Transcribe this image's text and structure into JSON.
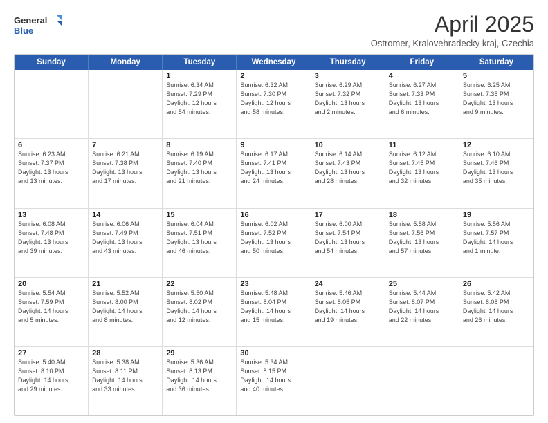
{
  "logo": {
    "line1": "General",
    "line2": "Blue"
  },
  "title": "April 2025",
  "location": "Ostromer, Kralovehradecky kraj, Czechia",
  "weekdays": [
    "Sunday",
    "Monday",
    "Tuesday",
    "Wednesday",
    "Thursday",
    "Friday",
    "Saturday"
  ],
  "rows": [
    [
      {
        "day": "",
        "info": ""
      },
      {
        "day": "",
        "info": ""
      },
      {
        "day": "1",
        "info": "Sunrise: 6:34 AM\nSunset: 7:29 PM\nDaylight: 12 hours\nand 54 minutes."
      },
      {
        "day": "2",
        "info": "Sunrise: 6:32 AM\nSunset: 7:30 PM\nDaylight: 12 hours\nand 58 minutes."
      },
      {
        "day": "3",
        "info": "Sunrise: 6:29 AM\nSunset: 7:32 PM\nDaylight: 13 hours\nand 2 minutes."
      },
      {
        "day": "4",
        "info": "Sunrise: 6:27 AM\nSunset: 7:33 PM\nDaylight: 13 hours\nand 6 minutes."
      },
      {
        "day": "5",
        "info": "Sunrise: 6:25 AM\nSunset: 7:35 PM\nDaylight: 13 hours\nand 9 minutes."
      }
    ],
    [
      {
        "day": "6",
        "info": "Sunrise: 6:23 AM\nSunset: 7:37 PM\nDaylight: 13 hours\nand 13 minutes."
      },
      {
        "day": "7",
        "info": "Sunrise: 6:21 AM\nSunset: 7:38 PM\nDaylight: 13 hours\nand 17 minutes."
      },
      {
        "day": "8",
        "info": "Sunrise: 6:19 AM\nSunset: 7:40 PM\nDaylight: 13 hours\nand 21 minutes."
      },
      {
        "day": "9",
        "info": "Sunrise: 6:17 AM\nSunset: 7:41 PM\nDaylight: 13 hours\nand 24 minutes."
      },
      {
        "day": "10",
        "info": "Sunrise: 6:14 AM\nSunset: 7:43 PM\nDaylight: 13 hours\nand 28 minutes."
      },
      {
        "day": "11",
        "info": "Sunrise: 6:12 AM\nSunset: 7:45 PM\nDaylight: 13 hours\nand 32 minutes."
      },
      {
        "day": "12",
        "info": "Sunrise: 6:10 AM\nSunset: 7:46 PM\nDaylight: 13 hours\nand 35 minutes."
      }
    ],
    [
      {
        "day": "13",
        "info": "Sunrise: 6:08 AM\nSunset: 7:48 PM\nDaylight: 13 hours\nand 39 minutes."
      },
      {
        "day": "14",
        "info": "Sunrise: 6:06 AM\nSunset: 7:49 PM\nDaylight: 13 hours\nand 43 minutes."
      },
      {
        "day": "15",
        "info": "Sunrise: 6:04 AM\nSunset: 7:51 PM\nDaylight: 13 hours\nand 46 minutes."
      },
      {
        "day": "16",
        "info": "Sunrise: 6:02 AM\nSunset: 7:52 PM\nDaylight: 13 hours\nand 50 minutes."
      },
      {
        "day": "17",
        "info": "Sunrise: 6:00 AM\nSunset: 7:54 PM\nDaylight: 13 hours\nand 54 minutes."
      },
      {
        "day": "18",
        "info": "Sunrise: 5:58 AM\nSunset: 7:56 PM\nDaylight: 13 hours\nand 57 minutes."
      },
      {
        "day": "19",
        "info": "Sunrise: 5:56 AM\nSunset: 7:57 PM\nDaylight: 14 hours\nand 1 minute."
      }
    ],
    [
      {
        "day": "20",
        "info": "Sunrise: 5:54 AM\nSunset: 7:59 PM\nDaylight: 14 hours\nand 5 minutes."
      },
      {
        "day": "21",
        "info": "Sunrise: 5:52 AM\nSunset: 8:00 PM\nDaylight: 14 hours\nand 8 minutes."
      },
      {
        "day": "22",
        "info": "Sunrise: 5:50 AM\nSunset: 8:02 PM\nDaylight: 14 hours\nand 12 minutes."
      },
      {
        "day": "23",
        "info": "Sunrise: 5:48 AM\nSunset: 8:04 PM\nDaylight: 14 hours\nand 15 minutes."
      },
      {
        "day": "24",
        "info": "Sunrise: 5:46 AM\nSunset: 8:05 PM\nDaylight: 14 hours\nand 19 minutes."
      },
      {
        "day": "25",
        "info": "Sunrise: 5:44 AM\nSunset: 8:07 PM\nDaylight: 14 hours\nand 22 minutes."
      },
      {
        "day": "26",
        "info": "Sunrise: 5:42 AM\nSunset: 8:08 PM\nDaylight: 14 hours\nand 26 minutes."
      }
    ],
    [
      {
        "day": "27",
        "info": "Sunrise: 5:40 AM\nSunset: 8:10 PM\nDaylight: 14 hours\nand 29 minutes."
      },
      {
        "day": "28",
        "info": "Sunrise: 5:38 AM\nSunset: 8:11 PM\nDaylight: 14 hours\nand 33 minutes."
      },
      {
        "day": "29",
        "info": "Sunrise: 5:36 AM\nSunset: 8:13 PM\nDaylight: 14 hours\nand 36 minutes."
      },
      {
        "day": "30",
        "info": "Sunrise: 5:34 AM\nSunset: 8:15 PM\nDaylight: 14 hours\nand 40 minutes."
      },
      {
        "day": "",
        "info": ""
      },
      {
        "day": "",
        "info": ""
      },
      {
        "day": "",
        "info": ""
      }
    ]
  ]
}
